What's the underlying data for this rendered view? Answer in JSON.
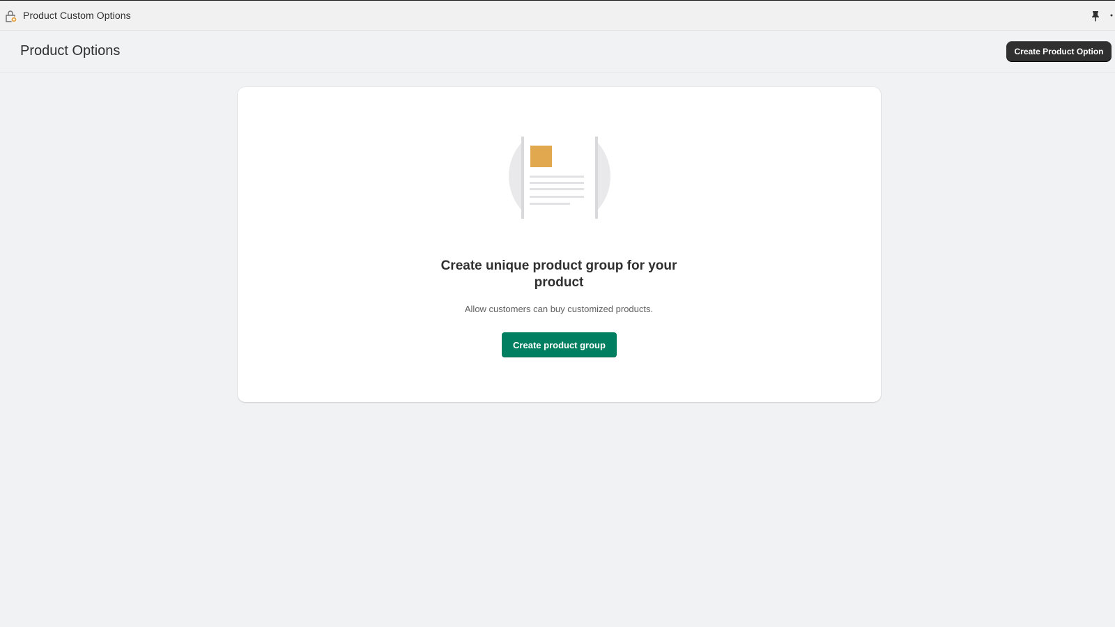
{
  "app_bar": {
    "title": "Product Custom Options",
    "icons": {
      "app": "app-logo-icon",
      "pin": "pin-icon",
      "more": "more-icon"
    }
  },
  "page_header": {
    "title": "Product Options",
    "primary_action_label": "Create Product Option"
  },
  "empty_state": {
    "illustration": "document-illustration",
    "heading": "Create unique product group for your product",
    "description": "Allow customers can buy customized products.",
    "action_label": "Create product group"
  },
  "colors": {
    "page_background": "#f1f2f4",
    "primary_action": "#303030",
    "empty_state_action": "#008060",
    "illustration_accent": "#e2a84f"
  }
}
